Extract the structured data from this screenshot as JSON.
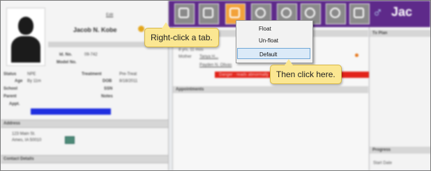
{
  "window": {
    "toolbar_icons": [
      "home-icon",
      "checklist-icon",
      "notes-icon",
      "lightbulb-icon",
      "globe-gear-icon",
      "umbrella-icon",
      "coins-icon",
      "camera-icon"
    ],
    "brand_fragment": "Jac",
    "colors": {
      "toolbar": "#5e2a8a",
      "active_tab": "#f2a23a",
      "alert": "#e2231a",
      "link_highlight": "#1f2fe0"
    }
  },
  "patient": {
    "edit_link": "Edit",
    "name": "Jacob N. Kobe",
    "id_label": "Id. No.",
    "id_value": "09-742",
    "model_label": "Model No.",
    "status_label": "Status",
    "status_value": "NPE",
    "age_label": "Age",
    "age_value": "By 11m",
    "school_label": "School",
    "parent_label": "Parent",
    "appt_label": "Appt.",
    "treatment_label": "Treatment",
    "treatment_value": "Pre-Treat",
    "dob_label": "DOB",
    "dob_value": "8/18/2011",
    "ssn_label": "SSN",
    "notes_label": "Notes"
  },
  "address": {
    "header": "Address",
    "line1": "123 Main St.",
    "line2": "Ames, IA 50010"
  },
  "contact": {
    "header": "Contact Details"
  },
  "center": {
    "line1": "8 yrs, 11 mos",
    "mother_label": "Mother",
    "mother_value": "Tanya H...",
    "line3": "Payden N. Olivas",
    "alert_text": "Danger - reads abnormally",
    "appointments_header": "Appointments"
  },
  "right": {
    "tx_plan_header": "Tx Plan",
    "progress_header": "Progress",
    "start_date": "Start Date"
  },
  "context_menu": {
    "items": [
      "Float",
      "Un-float",
      "Default"
    ]
  },
  "callouts": {
    "first": "Right-click a tab.",
    "second": "Then click here."
  }
}
